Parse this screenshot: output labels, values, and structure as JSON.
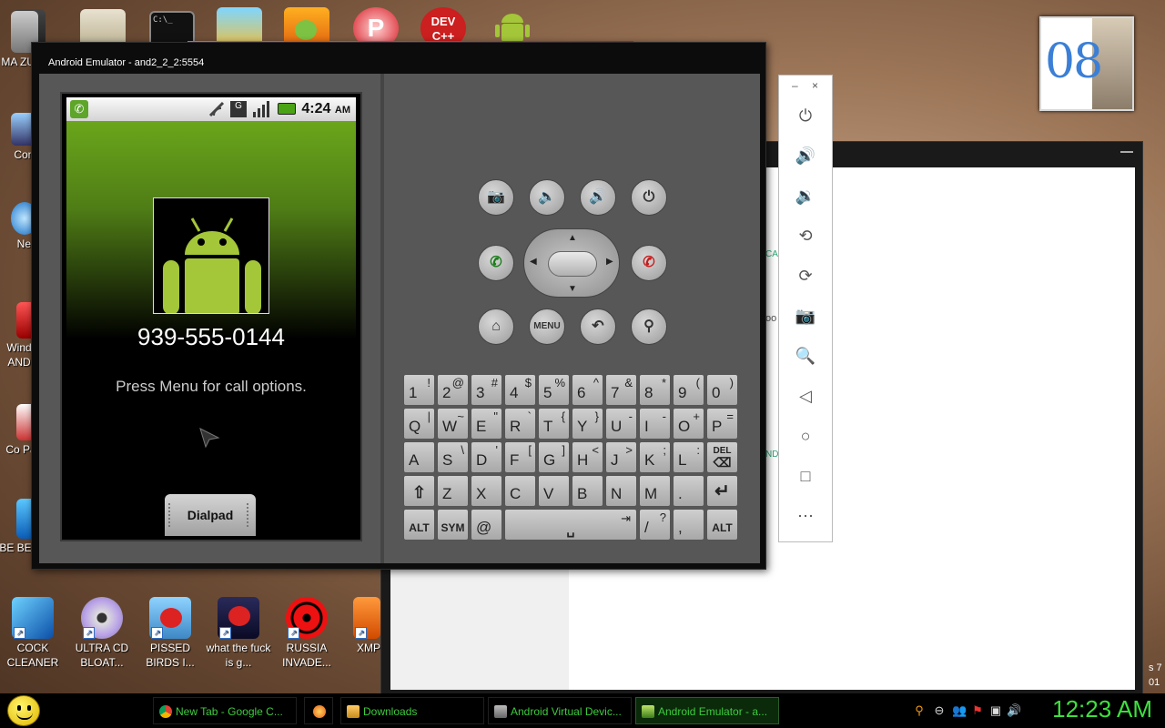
{
  "desktop": {
    "top_icons": [
      "console-icon",
      "document-icon",
      "terminal-icon",
      "scanner-icon",
      "bad-piggies-icon",
      "app-p-icon",
      "devcpp-icon",
      "android-icon"
    ],
    "top_labels": {
      "devcpp": "DEV C++"
    },
    "left_labels": [
      "MA ZUCK",
      "Com",
      "Net",
      "Wind AND",
      "Co Pa",
      "BE BEE"
    ],
    "bottom_icons": [
      {
        "label": "COCK CLEANER",
        "icon": "blue-book-icon"
      },
      {
        "label": "ULTRA CD BLOAT...",
        "icon": "cd-icon"
      },
      {
        "label": "PISSED BIRDS I...",
        "icon": "angry-birds-icon"
      },
      {
        "label": "what the fuck is g...",
        "icon": "angry-birds-space-icon"
      },
      {
        "label": "RUSSIA INVADE...",
        "icon": "radiation-icon"
      },
      {
        "label": "XMP",
        "icon": "xmp-icon"
      }
    ],
    "clock_widget": "08",
    "right_edge_text": [
      "s 7",
      "01"
    ]
  },
  "emulator": {
    "title": "Android Emulator - and2_2_2:5554",
    "status_time": "4:24",
    "status_ampm": "AM",
    "phone_number": "939-555-0144",
    "hint": "Press Menu for call options.",
    "dialpad": "Dialpad",
    "menu_label": "MENU",
    "keyboard": {
      "row1": [
        [
          "1",
          "!"
        ],
        [
          "2",
          "@"
        ],
        [
          "3",
          "#"
        ],
        [
          "4",
          "$"
        ],
        [
          "5",
          "%"
        ],
        [
          "6",
          "^"
        ],
        [
          "7",
          "&"
        ],
        [
          "8",
          "*"
        ],
        [
          "9",
          "("
        ],
        [
          "0",
          ")"
        ]
      ],
      "row2": [
        [
          "Q",
          "|"
        ],
        [
          "W",
          "~"
        ],
        [
          "E",
          "\""
        ],
        [
          "R",
          "`"
        ],
        [
          "T",
          "{"
        ],
        [
          "Y",
          "}"
        ],
        [
          "U",
          "-"
        ],
        [
          "I",
          "-"
        ],
        [
          "O",
          "+"
        ],
        [
          "P",
          "="
        ]
      ],
      "row3": [
        [
          "A",
          ""
        ],
        [
          "S",
          "\\"
        ],
        [
          "D",
          "'"
        ],
        [
          "F",
          "["
        ],
        [
          "G",
          "]"
        ],
        [
          "H",
          "<"
        ],
        [
          "J",
          ">"
        ],
        [
          "K",
          ";"
        ],
        [
          "L",
          ":"
        ]
      ],
      "row4": [
        "Z",
        "X",
        "C",
        "V",
        "B",
        "N",
        "M",
        "."
      ],
      "del_label": "DEL",
      "alt_label": "ALT",
      "sym_label": "SYM",
      "at": "@",
      "slash": "/",
      "question": "?",
      "comma": ","
    }
  },
  "bg_window_fragments": [
    "CA",
    "oo",
    "ND"
  ],
  "toolbar": {
    "min": "–",
    "close": "×"
  },
  "taskbar": {
    "tasks": [
      {
        "label": "New Tab - Google C...",
        "icon": "chrome-icon",
        "active": false
      },
      {
        "label": "Downloads",
        "icon": "folder-icon",
        "active": false
      },
      {
        "label": "Android Virtual Devic...",
        "icon": "avd-icon",
        "active": false
      },
      {
        "label": "Android Emulator - a...",
        "icon": "emulator-icon",
        "active": true
      }
    ],
    "time": "12:23 AM"
  },
  "colors": {
    "accent_green": "#3ecb3e",
    "android_green": "#a4c639",
    "emulator_body": "#575757"
  }
}
